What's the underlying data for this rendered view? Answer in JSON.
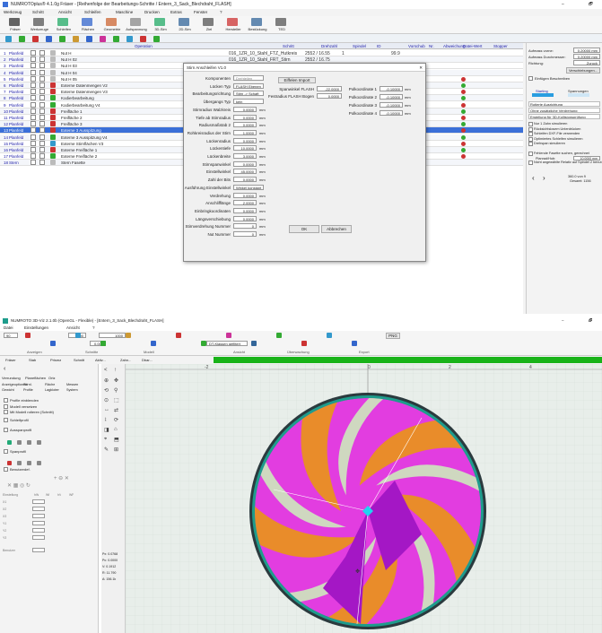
{
  "top_window": {
    "title": "NUMROTOplus® 4.1.0g Fräser - [Reihenfolge der Bearbeitungs-Schritte / Entern_3_Sack_Blechdraht_FLASH]",
    "menu": [
      "Werkzeug",
      "Schritt",
      "Ansicht",
      "Schleifen",
      "Maschine",
      "Drucken",
      "Extras",
      "Fenster",
      "?"
    ],
    "toolbar_labels": [
      "Fräser",
      "Werkzeuge",
      "Schleifen",
      "Flächen",
      "Geometrie",
      "Aufspannung",
      "3D-Sim",
      "2D-Sim",
      "Ziel",
      "Hersteller",
      "Bestückung",
      "TED"
    ],
    "columns": [
      "Operation",
      "Schritt",
      "Drehzahl",
      "Spindel",
      "ID",
      "Vorschub",
      "Nr.",
      "Abweichung",
      "Datei-Wert",
      "Stopper"
    ],
    "rows": [
      {
        "nr": "1",
        "type": "Planfeld",
        "op": "Nut H"
      },
      {
        "nr": "2",
        "type": "Planfeld",
        "op": "Nut H 02"
      },
      {
        "nr": "3",
        "type": "Planfeld",
        "op": "Nut H 03"
      },
      {
        "nr": "4",
        "type": "Planfeld",
        "op": "Nut H 04"
      },
      {
        "nr": "5",
        "type": "Planfeld",
        "op": "Nut H 05"
      },
      {
        "nr": "6",
        "type": "Planfeld",
        "op": "Externe Datenmengen V2"
      },
      {
        "nr": "7",
        "type": "Planfeld",
        "op": "Externe Datenmengen V3"
      },
      {
        "nr": "8",
        "type": "Planfeld",
        "op": "Kodierbearbeitung"
      },
      {
        "nr": "9",
        "type": "Planfeld",
        "op": "Kodierbearbeitung V4"
      },
      {
        "nr": "10",
        "type": "Planfeld",
        "op": "Freifläche 1"
      },
      {
        "nr": "11",
        "type": "Planfeld",
        "op": "Freifläche 2"
      },
      {
        "nr": "12",
        "type": "Planfeld",
        "op": "Freifläche 3"
      },
      {
        "nr": "13",
        "type": "Planfeld",
        "op": "Externe 3 Ausspitzung"
      },
      {
        "nr": "14",
        "type": "Planfeld",
        "op": "Externe 3 Ausspitzung V4"
      },
      {
        "nr": "15",
        "type": "Planfeld",
        "op": "Externe Stirnflächen V3"
      },
      {
        "nr": "16",
        "type": "Planfeld",
        "op": "Externe Freifläche 1"
      },
      {
        "nr": "17",
        "type": "Planfeld",
        "op": "Externe Freifläche 2"
      },
      {
        "nr": "18",
        "type": "Stern",
        "op": "Stern Fasette"
      }
    ],
    "row1_step": "016_1ZR_10_Stahl_FTZ_Hutkreis",
    "row1_rpm": "2552 / 16.55",
    "row1_val": "1",
    "row1_feed": "99.9",
    "row2_step": "016_1ZR_10_Stahl_FRT_Stirn",
    "row2_rpm": "2552 / 16.75",
    "right_panel": {
      "fields": [
        {
          "label": "Aufmass vorne:",
          "value": "0.20000 mm"
        },
        {
          "label": "Aufmass Durchmesser:",
          "value": "0.20000 mm"
        },
        {
          "label": "Richtung:",
          "value": "Zuruck"
        }
      ],
      "button_label": "Verschiebungen...",
      "check1": "Einfügen Beschreiben",
      "status1": "Starting",
      "status2": "Spannungen",
      "options": [
        "Rotierte Ausrichtung",
        "Ohne zusätzliche Verdrehung",
        "Erstellung für 3D-Kollisionsprüfung"
      ],
      "checks": [
        "Nur 1 Zahn simulieren",
        "Rücksichtslosem Unterdrücken",
        "Schleifen DXF-File verwenden",
        "Optimiertes Schleifen simulieren",
        "Drehspan simulieren",
        "Fehlende Fasette suchen, gerechnet",
        "Nicht angewählte Relativ auf Spindel 2 benutzen"
      ],
      "planrad_label": "Planrad/Hub:",
      "planrad_value": "10.0000 mm",
      "nav_text1": "360.0 von 9",
      "nav_text2": "Gesamt: 1156"
    }
  },
  "dialog": {
    "title": "Stirn Anschleifen V1.0",
    "fields_left": [
      {
        "label": "Komponenten",
        "value": "Drehteilen"
      },
      {
        "label": "Lücken Typ",
        "value": "FLASH Ebenen"
      },
      {
        "label": "Bearbeitungsrichtung",
        "value": "Stirn -> Schaft"
      },
      {
        "label": "Übergangs Typ",
        "value": "kein"
      },
      {
        "label": "Stirnradius Walzkreis",
        "value": "0.0000"
      },
      {
        "label": "Tiefe ab Stirnradius",
        "value": "0.0000"
      },
      {
        "label": "Radiusmaßstab 2",
        "value": "0.0000"
      },
      {
        "label": "Rohkreisradius der Stirn",
        "value": "1.0000"
      },
      {
        "label": "Lückenradius",
        "value": "0.0000"
      },
      {
        "label": "Lückentiefe",
        "value": "10.0000"
      },
      {
        "label": "Lückenbreite",
        "value": "3.0000"
      },
      {
        "label": "Stirnspanwinkel",
        "value": "0.0000"
      },
      {
        "label": "Einstellwinkel",
        "value": "45.0000"
      },
      {
        "label": "Zahl der Bits",
        "value": "0.0000"
      },
      {
        "label": "Ausführung Einstellwinkel",
        "value": "Winkel konstant"
      },
      {
        "label": "Verdrehung",
        "value": "0.0000"
      },
      {
        "label": "Anschlifflänge",
        "value": "2.0000"
      },
      {
        "label": "Einbringkoordinaten",
        "value": "0.0000"
      },
      {
        "label": "Längsverschiebung",
        "value": "0.0000"
      },
      {
        "label": "Stirnverdrehung Nummer",
        "value": "0"
      },
      {
        "label": "Nut Nummer",
        "value": "0"
      }
    ],
    "unit": "mm",
    "import_button": "Eiffelen Import",
    "mid_fields": [
      {
        "label": "Spanwinkel FLASH",
        "value": "-22.0000"
      },
      {
        "label": "Festradius FLASH Bogen",
        "value": "0.0000"
      }
    ],
    "right_fields": [
      {
        "label": "Polkoordinate 1",
        "value": "-0.10000"
      },
      {
        "label": "Polkoordinate 2",
        "value": "-0.10000"
      },
      {
        "label": "Polkoordinate 3",
        "value": "-0.10000"
      },
      {
        "label": "Polkoordinate 4",
        "value": "-0.10000"
      }
    ],
    "ok": "OK",
    "cancel": "Abbrechen"
  },
  "bottom_window": {
    "title": "NUMROTO 3D-Viz 2.1.0b (OpenGL - Flexible) - [Entern_3_Sack_Blechdraht_FLASH]",
    "menu": [
      "Datei",
      "Einstellungen",
      "Ansicht",
      "?"
    ],
    "toolbar": {
      "zoom": "1000",
      "scale": "1000",
      "value1": "90",
      "value2": "0.000",
      "dropdown": "DT-Klassen gefiltert",
      "png": "PNG"
    },
    "groups": [
      "Anzeigen",
      "Schnitte",
      "Modell",
      "Ansicht",
      "Überwachung",
      "Export"
    ],
    "second_bar": [
      "Fräser",
      "Stab",
      "Prisma",
      "Schnitt",
      "Aktiv...",
      "Zahn...",
      "Dbar..."
    ],
    "left_tabs": [
      "Verrundung",
      "Planeflächen",
      "Ortz"
    ],
    "left_subtabs": [
      "Anzeigeoptionen",
      "Stirnl.",
      "Fläche",
      "Messen",
      "Gewicht",
      "Profile",
      "Lagkloten",
      "System"
    ],
    "checks": [
      "Profile einblenden",
      "Modell versetzen",
      "Mit Modell rotieren (Schnitt)",
      "Schleifprofil",
      "Ausspanprofil",
      "Spanprofil",
      "Benutzerdef."
    ],
    "table_head": [
      "Einstellung",
      "hW",
      "Wf",
      "hV",
      "WF"
    ],
    "table_rows": [
      "X1",
      "X2",
      "X3",
      "Y1",
      "Y2",
      "Y3",
      "Benutzer"
    ],
    "readouts": [
      "Px: 0.0768",
      "Pc: 0.0000",
      "V: 0.1912",
      "R: 11.790",
      "A: 156.1k"
    ],
    "ruler_ticks": [
      "-2",
      "0",
      "2",
      "4"
    ]
  },
  "colors": {
    "titlebar": "#ffffff",
    "menu": "#f3f3f3",
    "row_odd": "#ffffff",
    "selected_row": "#3a6fd8",
    "green_bar": "#19b319",
    "canvas": "#e8eeea",
    "disc_edge": "#2b3a3e",
    "teal": "#1e9c8c",
    "magenta": "#e23de0",
    "purple": "#a417c5",
    "orange": "#e98c2a",
    "beige": "#cfd8c0",
    "cyan": "#22d4f0"
  }
}
